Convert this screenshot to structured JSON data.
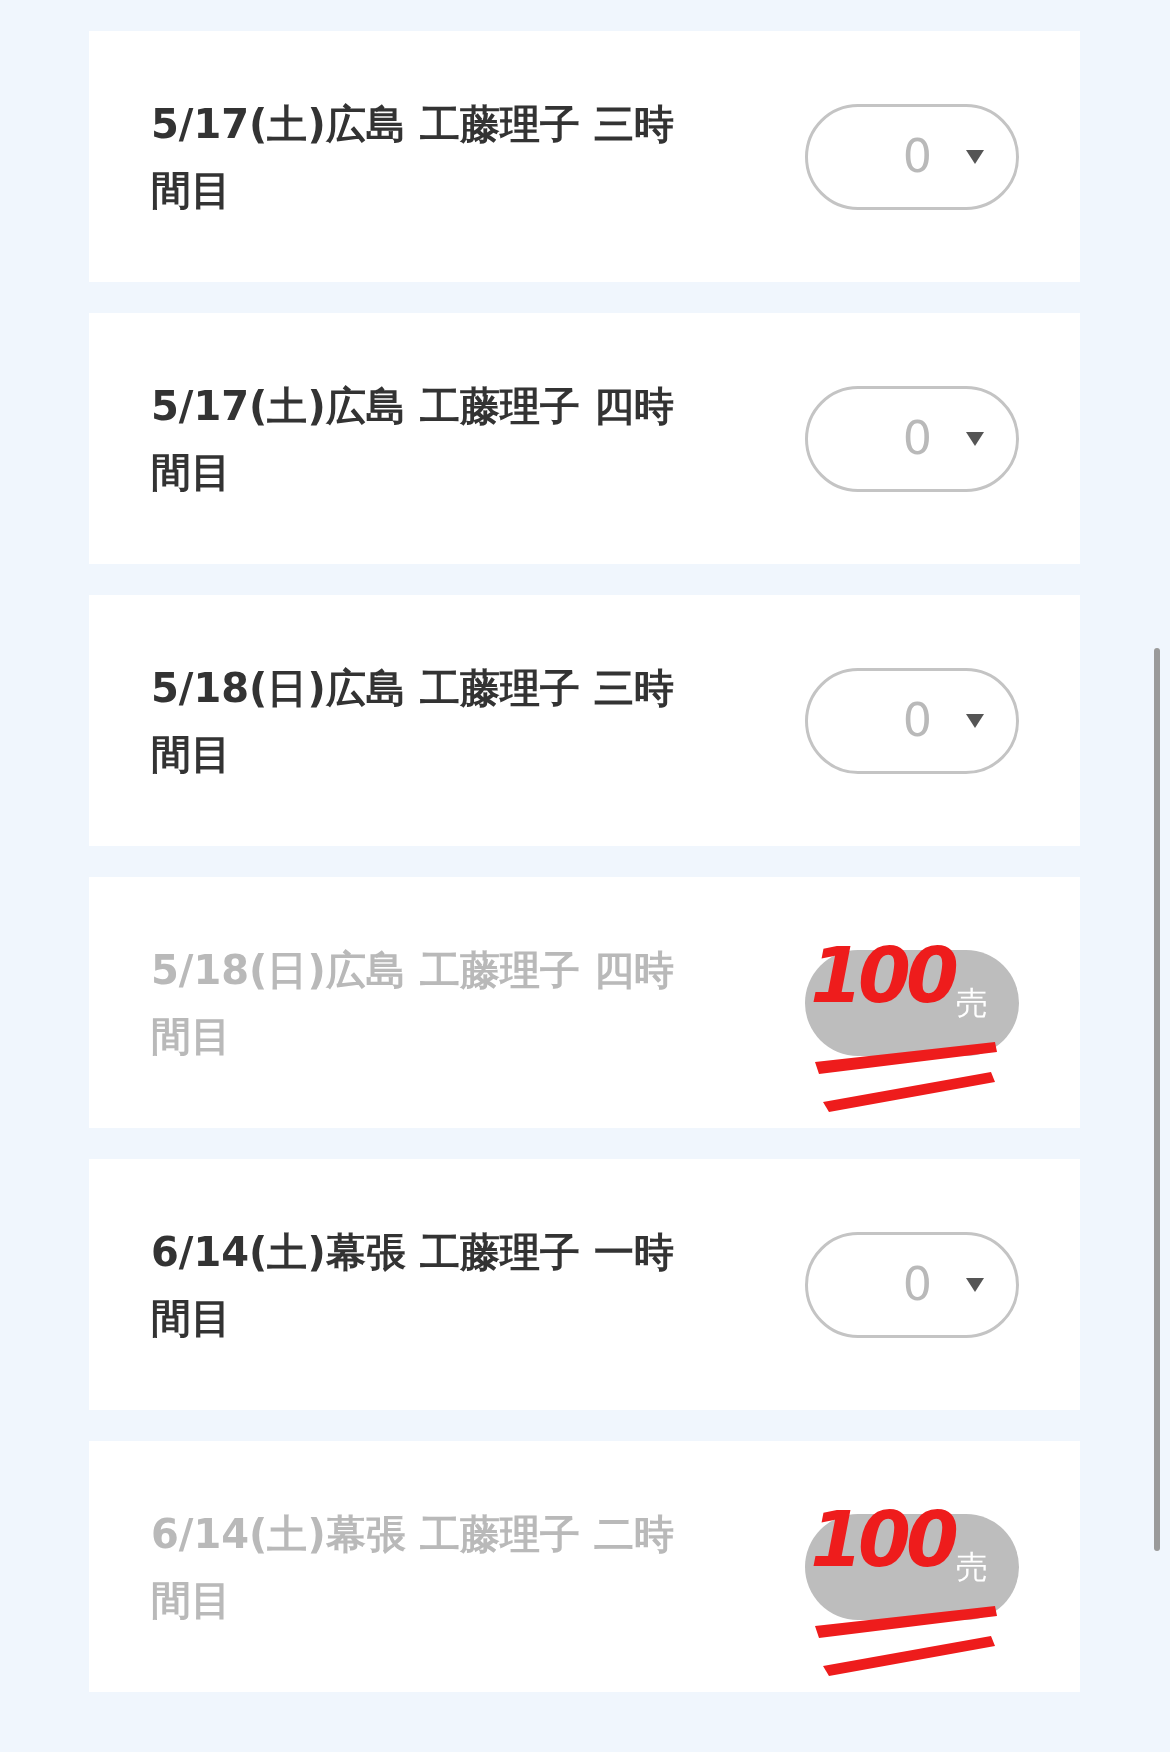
{
  "rows": [
    {
      "title": "5/17(土)広島 工藤理子 三時間目",
      "sold_out": false,
      "quantity": "0"
    },
    {
      "title": "5/17(土)広島 工藤理子 四時間目",
      "sold_out": false,
      "quantity": "0"
    },
    {
      "title": "5/18(日)広島 工藤理子 三時間目",
      "sold_out": false,
      "quantity": "0"
    },
    {
      "title": "5/18(日)広島 工藤理子 四時間目",
      "sold_out": true,
      "badge": "売",
      "sticker": "100"
    },
    {
      "title": "6/14(土)幕張 工藤理子 一時間目",
      "sold_out": false,
      "quantity": "0"
    },
    {
      "title": "6/14(土)幕張 工藤理子 二時間目",
      "sold_out": true,
      "badge": "売",
      "sticker": "100"
    }
  ]
}
